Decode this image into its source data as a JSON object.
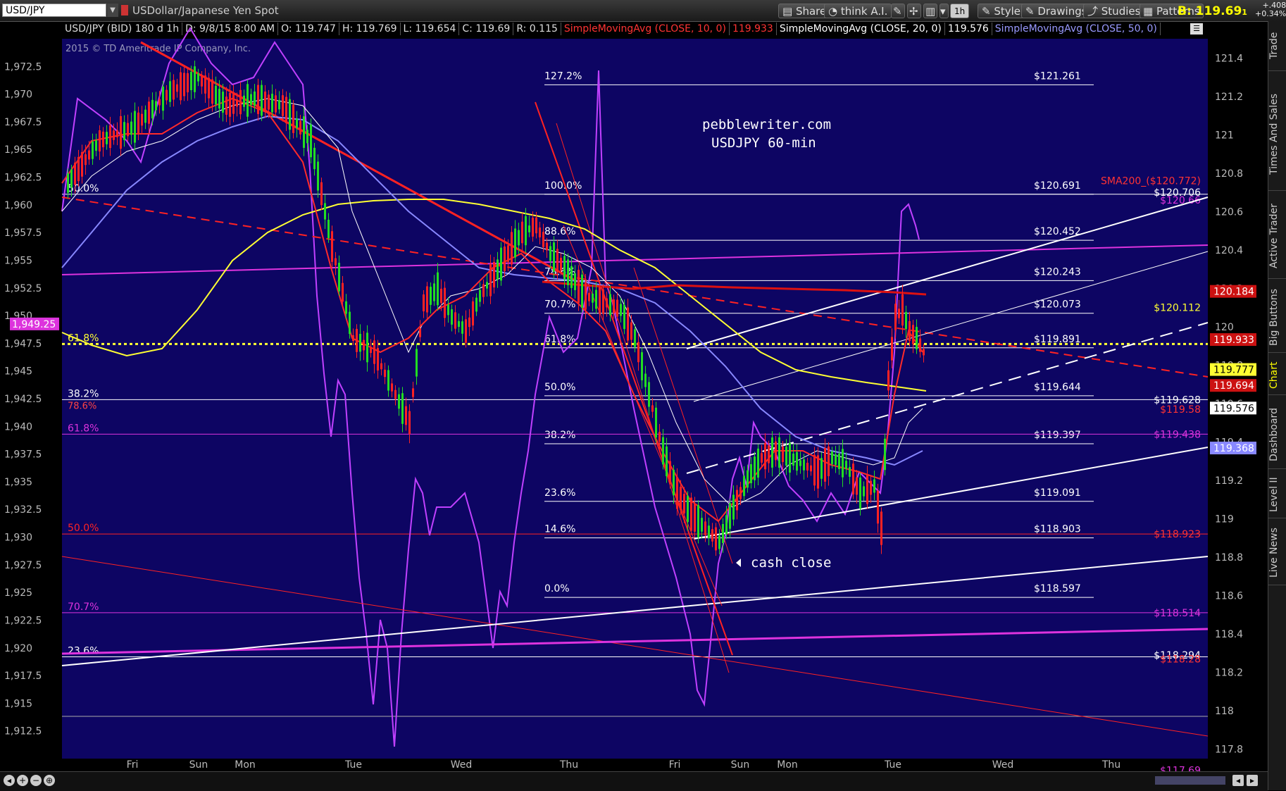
{
  "toolbar": {
    "symbol": "USD/JPY",
    "description": "USDollar/Japanese Yen Spot",
    "buttons": [
      "Share",
      "think A.I.",
      "1h",
      "Style",
      "Drawings",
      "Studies",
      "Patterns"
    ],
    "bid_label": "B: 119.69",
    "bid_suffix": "1",
    "change_abs": "+.408",
    "change_pct": "+0.34%"
  },
  "header": {
    "symbol_info": "USD/JPY (BID) 180 d 1h",
    "date": "D: 9/8/15 8:00 AM",
    "open": "O: 119.747",
    "high": "H: 119.769",
    "low": "L: 119.654",
    "close": "C: 119.69",
    "range": "R: 0.115",
    "sma10": "SimpleMovingAvg (CLOSE, 10, 0)",
    "sma10_val": "119.933",
    "sma20": "SimpleMovingAvg (CLOSE, 20, 0)",
    "sma20_val": "119.576",
    "sma50": "SimpleMovingAvg (CLOSE, 50, 0)"
  },
  "copyright": "2015 © TD Ameritrade IP Company, Inc.",
  "annotation_title": "pebblewriter.com",
  "annotation_subtitle": "USDJPY 60-min",
  "cash_close": "cash close",
  "sidebar_tabs": [
    "Trade",
    "Times And Sales",
    "Active Trader",
    "Big Buttons",
    "Chart",
    "Dashboard",
    "Level II",
    "Live News"
  ],
  "colors": {
    "plot_bg": "#0d0563",
    "candle_up": "#22dd22",
    "candle_down": "#ff2222",
    "sma10": "#ff2a2a",
    "sma20": "#ffffff",
    "sma50": "#8888ff",
    "sma200": "#ffff33",
    "spx": "#c040ff",
    "fib_line": "#ffffff",
    "fib_magenta": "#dd33dd"
  },
  "chart_data": {
    "type": "candlestick",
    "x_ticks": [
      "Fri",
      "Sun",
      "Mon",
      "Tue",
      "Wed",
      "Thu",
      "Fri",
      "Sun",
      "Mon",
      "Tue",
      "Wed",
      "Thu"
    ],
    "right_axis": {
      "ticks": [
        "121.4",
        "121.2",
        "121",
        "120.8",
        "120.6",
        "120.4",
        "120.2",
        "120",
        "119.8",
        "119.6",
        "119.4",
        "119.2",
        "119",
        "118.8",
        "118.6",
        "118.4",
        "118.2",
        "118",
        "117.8"
      ],
      "min": 117.75,
      "max": 121.5
    },
    "left_axis": {
      "ticks": [
        "1,972.5",
        "1,970",
        "1,967.5",
        "1,965",
        "1,962.5",
        "1,960",
        "1,957.5",
        "1,955",
        "1,952.5",
        "1,950",
        "1,947.5",
        "1,945",
        "1,942.5",
        "1,940",
        "1,937.5",
        "1,935",
        "1,932.5",
        "1,930",
        "1,927.5",
        "1,925",
        "1,922.5",
        "1,920",
        "1,917.5",
        "1,915",
        "1,912.5"
      ]
    },
    "fib_levels": [
      {
        "pct": "127.2%",
        "price": "$121.261"
      },
      {
        "pct": "100.0%",
        "price": "$120.691"
      },
      {
        "pct": "88.6%",
        "price": "$120.452"
      },
      {
        "pct": "78.6%",
        "price": "$120.243"
      },
      {
        "pct": "70.7%",
        "price": "$120.073"
      },
      {
        "pct": "61.8%",
        "price": "$119.891"
      },
      {
        "pct": "50.0%",
        "price": "$119.644"
      },
      {
        "pct": "38.2%",
        "price": "$119.397"
      },
      {
        "pct": "23.6%",
        "price": "$119.091"
      },
      {
        "pct": "14.6%",
        "price": "$118.903"
      },
      {
        "pct": "0.0%",
        "price": "$118.597"
      }
    ],
    "left_fib_labels": [
      "50.0%",
      "61.8%",
      "38.2%",
      "61.8%",
      "50.0%",
      "70.7%",
      "23.6%",
      "78.6%"
    ],
    "right_level_labels": [
      "SMA200_($120.772)",
      "$120.706",
      "$120.66",
      "$120.112",
      "$119.628",
      "$119.58",
      "$119.438",
      "$118.923",
      "$118.514",
      "$118.294",
      "$118.28",
      "$117.69"
    ],
    "price_badges": [
      {
        "label": "120.184",
        "color": "#cc1111"
      },
      {
        "label": "119.933",
        "color": "#cc1111"
      },
      {
        "label": "119.777",
        "color": "#ffff33"
      },
      {
        "label": "119.694",
        "color": "#cc1111"
      },
      {
        "label": "119.576",
        "color": "#ffffff"
      },
      {
        "label": "119.368",
        "color": "#8888ff"
      }
    ],
    "spx_badge": "1,949.25"
  }
}
